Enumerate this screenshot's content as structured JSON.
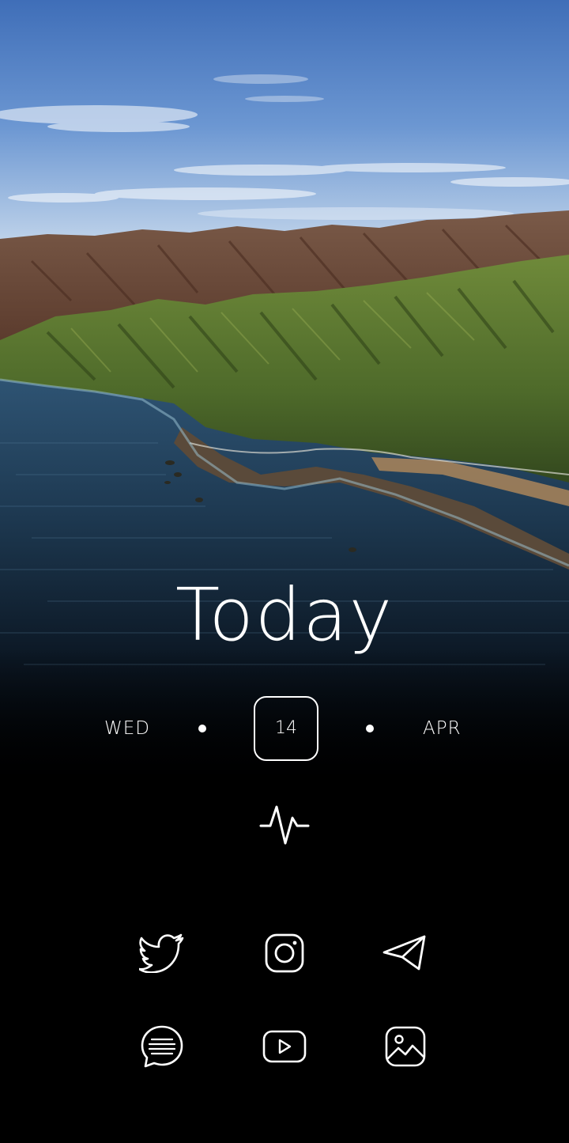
{
  "widget": {
    "title": "Today",
    "weekday": "WED",
    "day": "14",
    "month": "APR"
  },
  "app_icons": [
    {
      "name": "twitter-icon"
    },
    {
      "name": "instagram-icon"
    },
    {
      "name": "telegram-icon"
    },
    {
      "name": "messages-icon"
    },
    {
      "name": "youtube-icon"
    },
    {
      "name": "gallery-icon"
    }
  ],
  "colors": {
    "foreground": "#ffffff",
    "background": "#000000"
  }
}
